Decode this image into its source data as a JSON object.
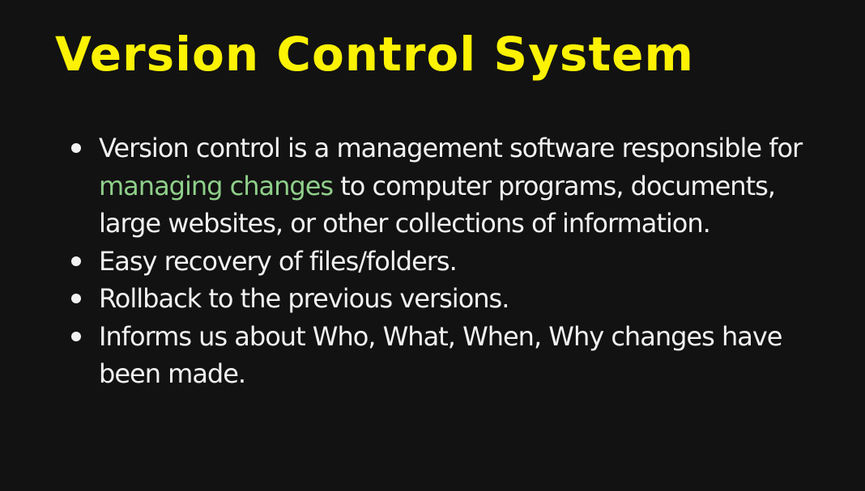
{
  "slide": {
    "title": "Version Control System",
    "bullets": [
      {
        "before": "Version control is a management software responsible for ",
        "highlight": "managing changes",
        "after": " to computer programs, documents, large websites, or other collections of information."
      },
      {
        "text": "Easy recovery of files/folders."
      },
      {
        "text": "Rollback to the previous versions."
      },
      {
        "text": "Informs us about Who, What, When, Why changes have been made."
      }
    ]
  },
  "colors": {
    "background": "#121212",
    "title": "#fbf204",
    "body_text": "#f2f2f2",
    "highlight": "#8fcf8a"
  }
}
